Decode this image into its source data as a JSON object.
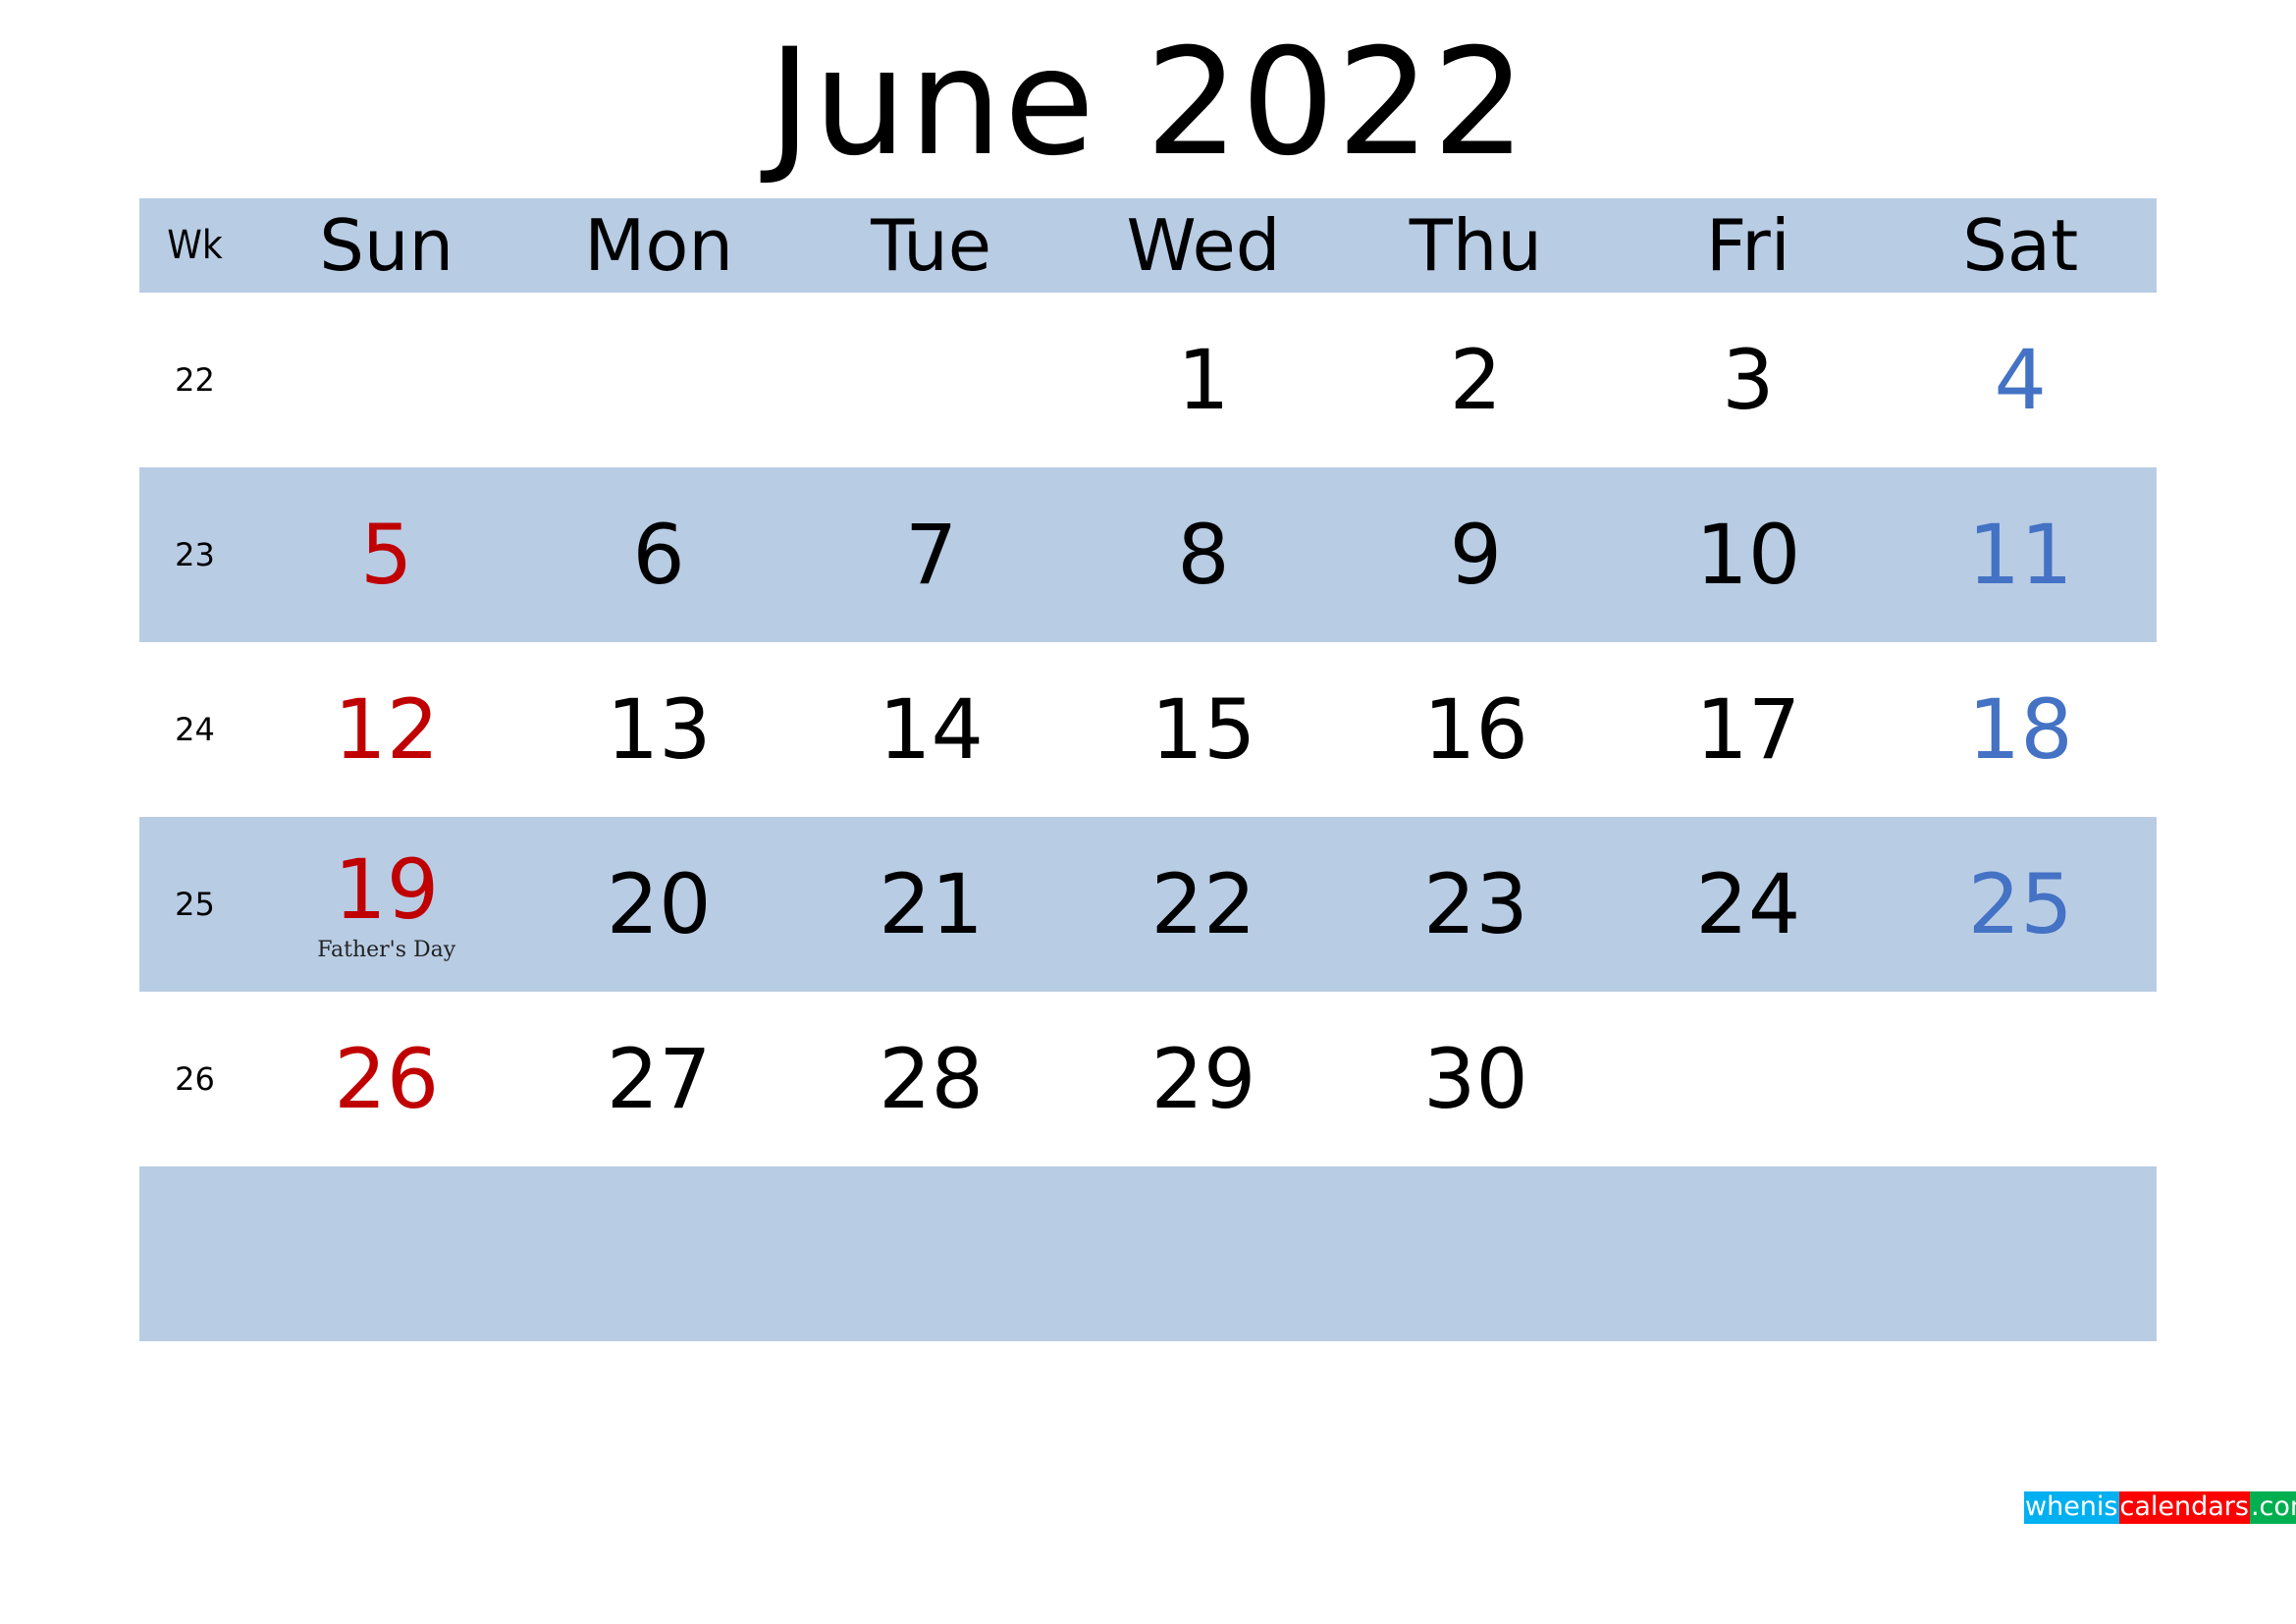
{
  "title": "June 2022",
  "colors": {
    "band": "#B8CCE4",
    "sunday": "#C00000",
    "saturday": "#4472C4",
    "text": "#000000"
  },
  "header": {
    "wk": "Wk",
    "days": [
      "Sun",
      "Mon",
      "Tue",
      "Wed",
      "Thu",
      "Fri",
      "Sat"
    ]
  },
  "weeks": [
    {
      "wk": "22",
      "days": [
        "",
        "",
        "",
        "1",
        "2",
        "3",
        "4"
      ],
      "shaded": false
    },
    {
      "wk": "23",
      "days": [
        "5",
        "6",
        "7",
        "8",
        "9",
        "10",
        "11"
      ],
      "shaded": true
    },
    {
      "wk": "24",
      "days": [
        "12",
        "13",
        "14",
        "15",
        "16",
        "17",
        "18"
      ],
      "shaded": false
    },
    {
      "wk": "25",
      "days": [
        "19",
        "20",
        "21",
        "22",
        "23",
        "24",
        "25"
      ],
      "shaded": true
    },
    {
      "wk": "26",
      "days": [
        "26",
        "27",
        "28",
        "29",
        "30",
        "",
        ""
      ],
      "shaded": false
    },
    {
      "wk": "",
      "days": [
        "",
        "",
        "",
        "",
        "",
        "",
        ""
      ],
      "shaded": true
    }
  ],
  "holidays": {
    "19": "Father's Day"
  },
  "logo": {
    "part1": "whenis",
    "part2": "calendars",
    "part3": ".com"
  }
}
